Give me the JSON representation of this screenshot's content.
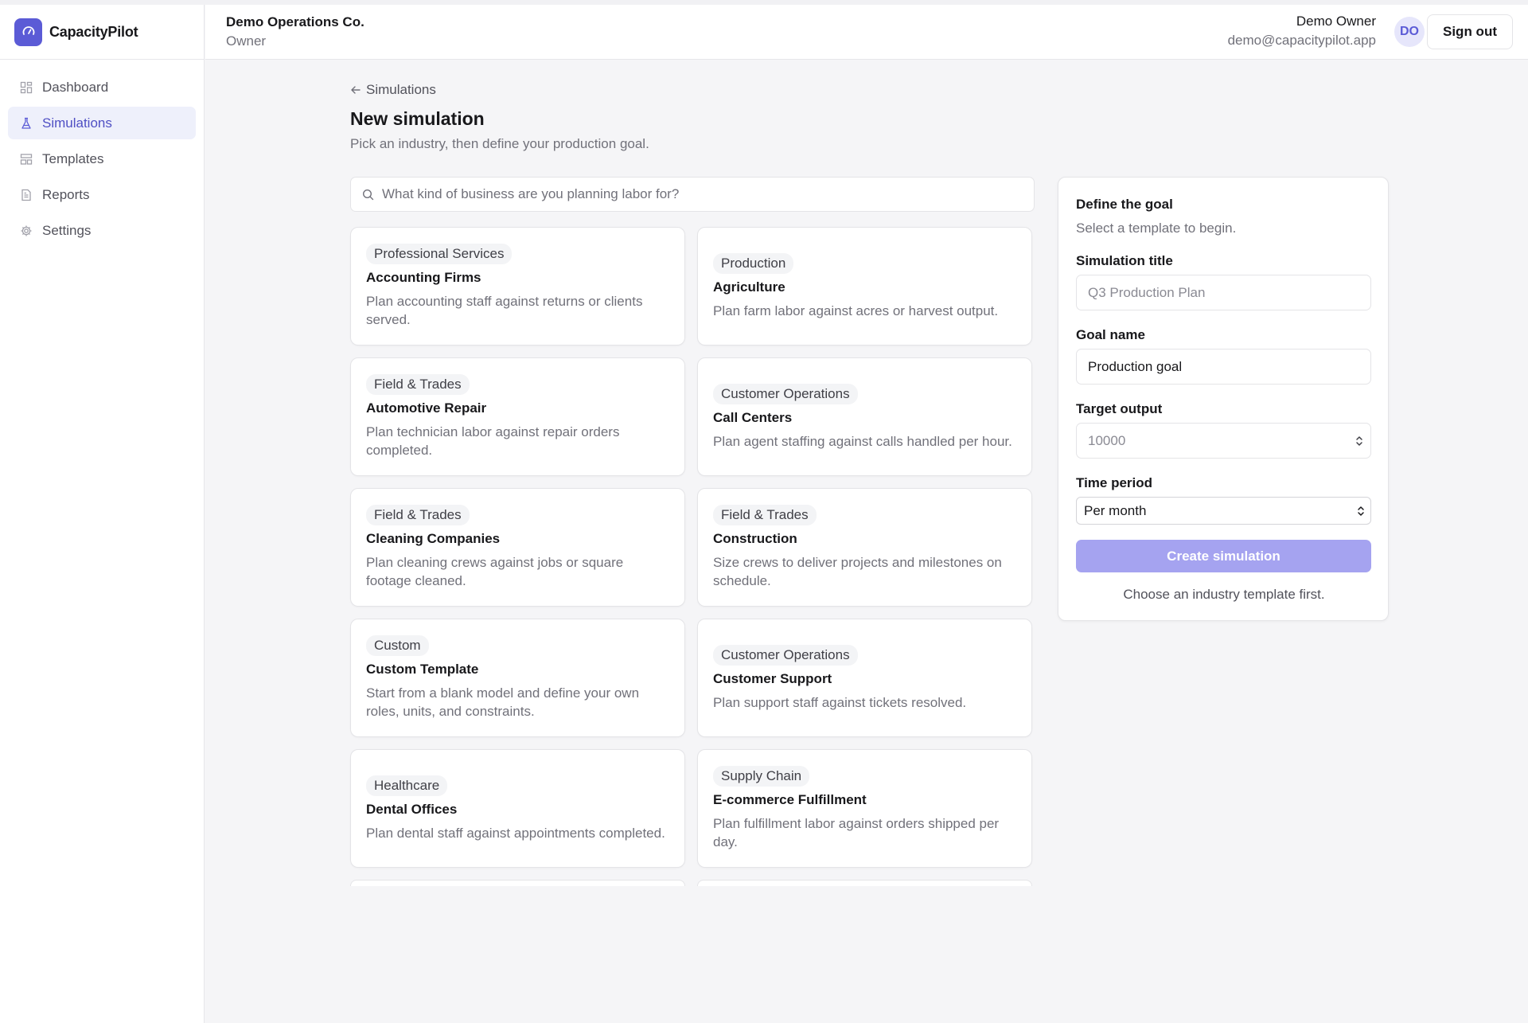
{
  "brand": {
    "name": "CapacityPilot"
  },
  "colors": {
    "accent": "#5b5bd6",
    "accent_disabled": "#a5a3f0",
    "active_nav_bg": "#eef0fb"
  },
  "sidebar": {
    "items": [
      {
        "label": "Dashboard",
        "icon": "dashboard-icon",
        "active": false
      },
      {
        "label": "Simulations",
        "icon": "flask-icon",
        "active": true
      },
      {
        "label": "Templates",
        "icon": "templates-icon",
        "active": false
      },
      {
        "label": "Reports",
        "icon": "report-icon",
        "active": false
      },
      {
        "label": "Settings",
        "icon": "gear-icon",
        "active": false
      }
    ]
  },
  "header": {
    "org_name": "Demo Operations Co.",
    "org_role": "Owner",
    "user_name": "Demo Owner",
    "user_email": "demo@capacitypilot.app",
    "avatar_initials": "DO",
    "sign_out_label": "Sign out"
  },
  "main": {
    "back_label": "Simulations",
    "title": "New simulation",
    "subtitle": "Pick an industry, then define your production goal.",
    "search_placeholder": "What kind of business are you planning labor for?",
    "cards": [
      {
        "tag": "Professional Services",
        "title": "Accounting Firms",
        "description": "Plan accounting staff against returns or clients served."
      },
      {
        "tag": "Production",
        "title": "Agriculture",
        "description": "Plan farm labor against acres or harvest output."
      },
      {
        "tag": "Field & Trades",
        "title": "Automotive Repair",
        "description": "Plan technician labor against repair orders completed."
      },
      {
        "tag": "Customer Operations",
        "title": "Call Centers",
        "description": "Plan agent staffing against calls handled per hour."
      },
      {
        "tag": "Field & Trades",
        "title": "Cleaning Companies",
        "description": "Plan cleaning crews against jobs or square footage cleaned."
      },
      {
        "tag": "Field & Trades",
        "title": "Construction",
        "description": "Size crews to deliver projects and milestones on schedule."
      },
      {
        "tag": "Custom",
        "title": "Custom Template",
        "description": "Start from a blank model and define your own roles, units, and constraints."
      },
      {
        "tag": "Customer Operations",
        "title": "Customer Support",
        "description": "Plan support staff against tickets resolved."
      },
      {
        "tag": "Healthcare",
        "title": "Dental Offices",
        "description": "Plan dental staff against appointments completed."
      },
      {
        "tag": "Supply Chain",
        "title": "E-commerce Fulfillment",
        "description": "Plan fulfillment labor against orders shipped per day."
      }
    ]
  },
  "goal_panel": {
    "title": "Define the goal",
    "subtitle": "Select a template to begin.",
    "simulation_title_label": "Simulation title",
    "simulation_title_placeholder": "Q3 Production Plan",
    "goal_name_label": "Goal name",
    "goal_name_value": "Production goal",
    "target_output_label": "Target output",
    "target_output_placeholder": "10000",
    "time_period_label": "Time period",
    "time_period_value": "Per month",
    "create_label": "Create simulation",
    "hint": "Choose an industry template first."
  }
}
